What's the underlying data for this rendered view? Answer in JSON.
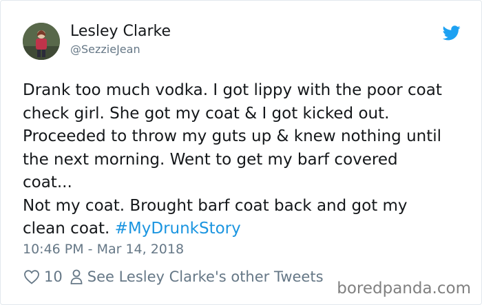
{
  "author": {
    "name": "Lesley Clarke",
    "handle": "@SezzieJean"
  },
  "icons": {
    "avatar": "profile-photo",
    "brand": "twitter-bird-icon",
    "like": "heart-outline-icon",
    "profile": "person-outline-icon"
  },
  "tweet": {
    "lines": [
      "Drank too much vodka. I got lippy with the poor coat",
      "check girl. She got my coat & I got kicked out.",
      "Proceeded to throw my guts up & knew nothing until",
      "the next morning. Went to get my barf covered",
      "coat...",
      "Not my coat. Brought barf coat back and got my"
    ],
    "last_line_text": "clean coat. ",
    "hashtag": "#MyDrunkStory",
    "timestamp": "10:46 PM - Mar 14, 2018"
  },
  "actions": {
    "like_count": "10",
    "other_tweets_link": "See Lesley Clarke's other Tweets"
  },
  "watermark": "boredpanda.com",
  "colors": {
    "text": "#14171a",
    "muted": "#657786",
    "link": "#1b95e0",
    "twitter_blue": "#1da1f2",
    "watermark": "#808080"
  }
}
